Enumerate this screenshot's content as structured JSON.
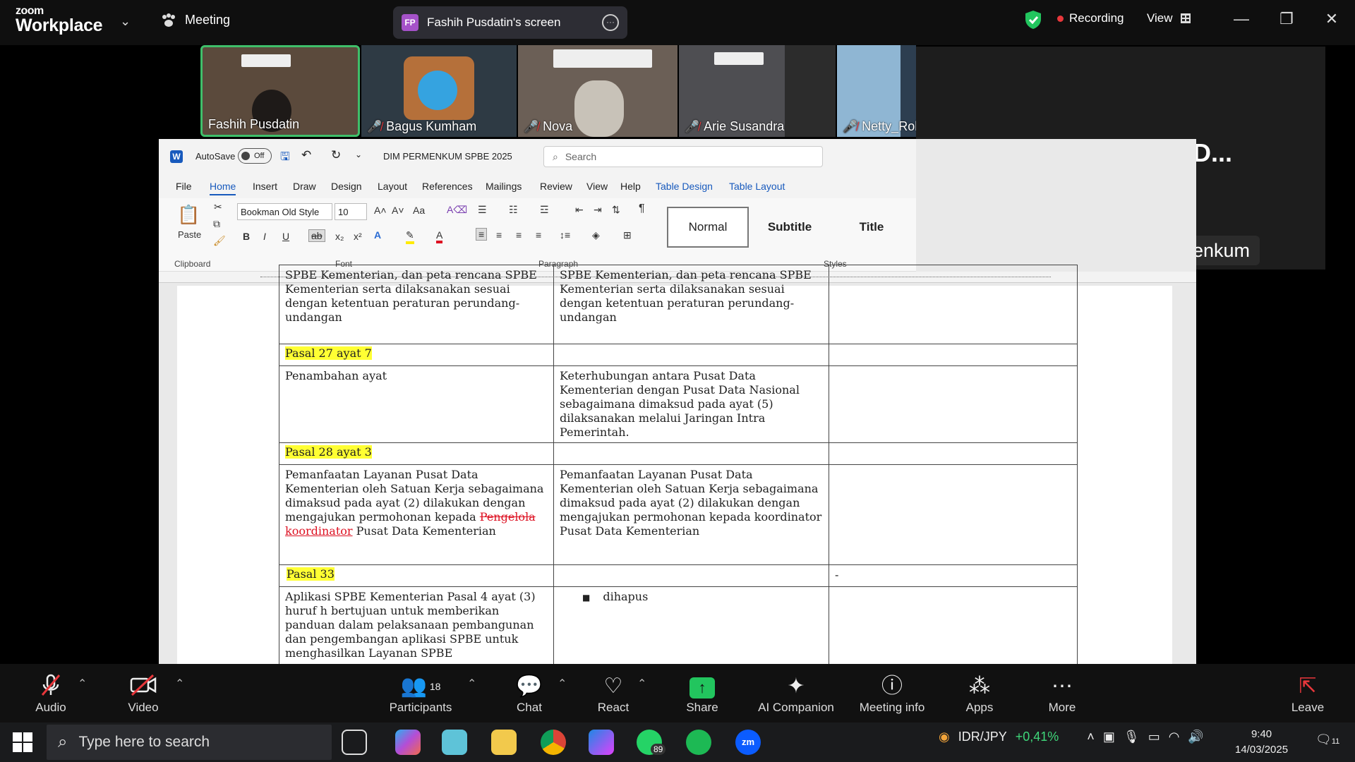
{
  "app": {
    "logo_top": "zoom",
    "logo_bottom": "Workplace",
    "meeting_label": "Meeting",
    "screen_share": "Fashih Pusdatin's screen",
    "screen_avatar": "FP",
    "recording": "Recording",
    "view": "View"
  },
  "participants": [
    {
      "name": "Fashih Pusdatin",
      "muted": false,
      "bg": "#5b4a3c"
    },
    {
      "name": "Bagus Kumham",
      "muted": true,
      "bg": "#2e3a44"
    },
    {
      "name": "Nova",
      "muted": true,
      "bg": "#6b5f56"
    },
    {
      "name": "Arie Susandra",
      "muted": true,
      "bg": "#4e4e52"
    },
    {
      "name": "Netty_Roh",
      "muted": true,
      "bg": "#2d3e50"
    }
  ],
  "speaker": {
    "title": "Robe Dir Cang D...",
    "name": "Robe Dir Cang DJPP Kemenkum"
  },
  "word": {
    "autosave": "AutoSave",
    "autosave_state": "Off",
    "doc_name": "DIM PERMENKUM SPBE 2025",
    "search_placeholder": "Search",
    "tabs": [
      "File",
      "Home",
      "Insert",
      "Draw",
      "Design",
      "Layout",
      "References",
      "Mailings",
      "Review",
      "View",
      "Help",
      "Table Design",
      "Table Layout"
    ],
    "active_tab": "Home",
    "font": "Bookman Old Style",
    "size": "10",
    "paste": "Paste",
    "groups": {
      "clipboard": "Clipboard",
      "font": "Font",
      "paragraph": "Paragraph",
      "styles": "Styles"
    },
    "styles": [
      "Normal",
      "Subtitle",
      "Title"
    ],
    "rows": [
      {
        "c1": "SPBE Kementerian, dan peta rencana SPBE Kementerian serta dilaksanakan sesuai dengan ketentuan peraturan perundang-undangan",
        "c2": "SPBE Kementerian, dan peta rencana SPBE Kementerian serta dilaksanakan sesuai dengan ketentuan peraturan perundang-undangan",
        "c3": ""
      },
      {
        "head": "Pasal 27 ayat 7"
      },
      {
        "c1": "Penambahan ayat",
        "c2": "Keterhubungan antara Pusat Data Kementerian dengan Pusat Data Nasional sebagaimana dimaksud pada ayat (5) dilaksanakan melalui Jaringan Intra Pemerintah.",
        "c3": ""
      },
      {
        "head": "Pasal 28 ayat 3"
      },
      {
        "c1_a": "Pemanfaatan Layanan Pusat Data Kementerian oleh Satuan Kerja sebagaimana dimaksud pada ayat (2) dilakukan dengan mengajukan permohonan kepada",
        "c1_del": "Pengelola",
        "c1_ins": "koordinator",
        "c1_b": "Pusat Data Kementerian",
        "c2": "Pemanfaatan Layanan Pusat Data Kementerian oleh Satuan Kerja sebagaimana dimaksud pada ayat (2) dilakukan dengan mengajukan permohonan kepada koordinator Pusat Data Kementerian",
        "c3": ""
      },
      {
        "head": "Pasal 33",
        "c3": "-"
      },
      {
        "c1": "Aplikasi SPBE Kementerian Pasal 4 ayat (3) huruf h bertujuan untuk memberikan panduan dalam pelaksanaan pembangunan dan pengembangan aplikasi SPBE untuk menghasilkan Layanan SPBE",
        "c2": "dihapus",
        "c3": ""
      }
    ]
  },
  "toolbar": {
    "audio": "Audio",
    "video": "Video",
    "participants": "Participants",
    "participant_count": "18",
    "chat": "Chat",
    "react": "React",
    "share": "Share",
    "ai": "AI Companion",
    "info": "Meeting info",
    "apps": "Apps",
    "more": "More",
    "leave": "Leave"
  },
  "taskbar": {
    "search": "Type here to search",
    "whatsapp_badge": "89",
    "ticker": "IDR/JPY",
    "ticker_change": "+0,41%",
    "time": "9:40",
    "date": "14/03/2025",
    "notif": "11"
  },
  "colors": {
    "accent": "#0b5cff",
    "highlight": "#ffff33",
    "recording": "#e8373b",
    "share": "#22c55e",
    "pill": "#a552c9"
  },
  "icons": [
    "search-icon",
    "shield-icon",
    "mic-off-icon",
    "video-off-icon",
    "participants-icon",
    "chat-icon",
    "react-icon",
    "share-icon",
    "ai-icon",
    "info-icon",
    "apps-icon",
    "more-icon",
    "leave-icon"
  ]
}
